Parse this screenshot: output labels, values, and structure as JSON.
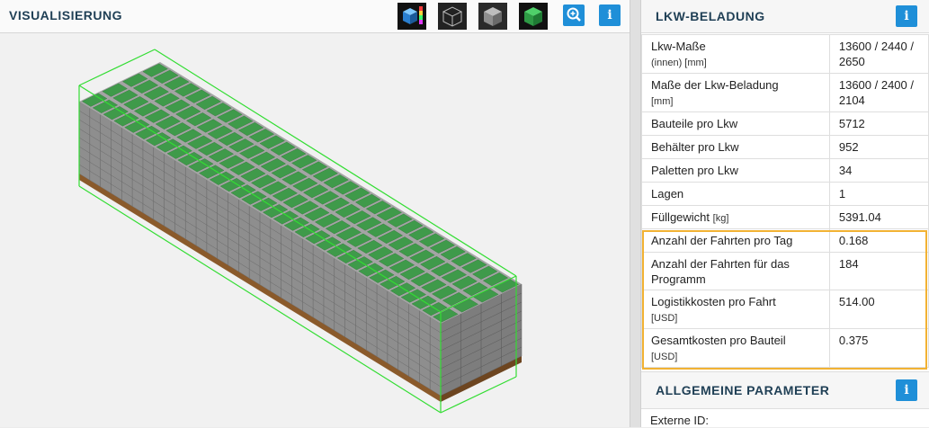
{
  "visualisation": {
    "title": "VISUALISIERUNG",
    "toolbar": [
      {
        "name": "color-view-button",
        "icon": "color-palette-cube-icon"
      },
      {
        "name": "wireframe-view-button",
        "icon": "wireframe-cube-icon"
      },
      {
        "name": "grey-view-button",
        "icon": "grey-solid-cube-icon"
      },
      {
        "name": "green-view-button",
        "icon": "green-solid-cube-icon"
      }
    ],
    "zoom_icon": "zoom-icon",
    "info_label": "i",
    "scene": {
      "container_outline_color": "#33dd33",
      "box_color": "#3f9a4a",
      "box_side_color": "#8e8e8e",
      "pallet_color": "#8a5a2b"
    }
  },
  "lkw_beladung": {
    "title": "LKW-BELADUNG",
    "info_label": "i",
    "rows": [
      {
        "label": "Lkw-Maße",
        "unit": "(innen) [mm]",
        "value": "13600 / 2440 / 2650"
      },
      {
        "label": "Maße der Lkw-Beladung",
        "unit": "[mm]",
        "value": "13600 / 2400 / 2104"
      },
      {
        "label": "Bauteile pro Lkw",
        "unit": "",
        "value": "5712"
      },
      {
        "label": "Behälter pro Lkw",
        "unit": "",
        "value": "952"
      },
      {
        "label": "Paletten pro Lkw",
        "unit": "",
        "value": "34"
      },
      {
        "label": "Lagen",
        "unit": "",
        "value": "1"
      },
      {
        "label": "Füllgewicht",
        "unit": "[kg]",
        "value": "5391.04"
      },
      {
        "label": "Anzahl der Fahrten pro Tag",
        "unit": "",
        "value": "0.168"
      },
      {
        "label": "Anzahl der Fahrten für das Programm",
        "unit": "",
        "value": "184"
      },
      {
        "label": "Logistikkosten pro Fahrt",
        "unit": "[USD]",
        "value": "514.00"
      },
      {
        "label": "Gesamtkosten pro Bauteil",
        "unit": "[USD]",
        "value": "0.375"
      }
    ],
    "highlight_color": "#f2b233"
  },
  "allgemeine_parameter": {
    "title": "ALLGEMEINE PARAMETER",
    "info_label": "i",
    "externe_id_label": "Externe ID:"
  },
  "colors": {
    "accent_blue": "#1f8fd8",
    "title_color": "#1f3f55"
  }
}
